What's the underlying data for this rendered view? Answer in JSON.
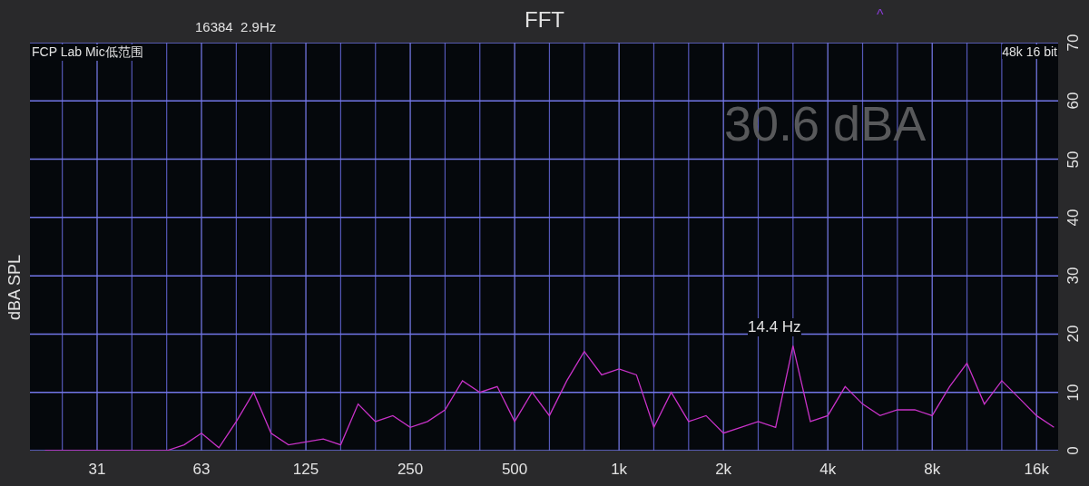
{
  "header": {
    "sample_info": "16384  2.9Hz",
    "marker": "^"
  },
  "plot": {
    "format": "48k 16 bit",
    "level_reading": "30.6 dBA",
    "peak_label": "14.4 Hz",
    "chart_data": {
      "type": "line",
      "title": "FFT",
      "ylabel": "dBA SPL",
      "ylim": [
        0,
        70
      ],
      "grid": true,
      "categories": [
        null,
        null,
        null,
        "31",
        null,
        null,
        null,
        null,
        null,
        "63",
        null,
        null,
        null,
        null,
        null,
        "125",
        null,
        null,
        null,
        null,
        null,
        "250",
        null,
        null,
        null,
        null,
        null,
        "500",
        null,
        null,
        null,
        null,
        null,
        "1k",
        null,
        null,
        null,
        null,
        null,
        "2k",
        null,
        null,
        null,
        null,
        null,
        "4k",
        null,
        null,
        null,
        null,
        null,
        "8k",
        null,
        null,
        null,
        null,
        null,
        "16k",
        null
      ],
      "series": [
        {
          "name": "FCP Lab Mic低范围",
          "color": "#c832c8",
          "values": [
            0,
            0,
            0,
            0,
            0,
            0,
            0,
            0,
            1,
            3,
            0.5,
            5,
            10,
            3,
            1,
            1.5,
            2,
            1,
            8,
            5,
            6,
            4,
            5,
            7,
            12,
            10,
            11,
            5,
            10,
            6,
            12,
            17,
            13,
            14,
            13,
            4,
            10,
            5,
            6,
            3,
            4,
            5,
            4,
            18,
            5,
            6,
            11,
            8,
            6,
            7,
            7,
            6,
            11,
            15,
            8,
            12,
            9,
            6,
            4
          ]
        }
      ],
      "yticks": [
        {
          "value": 0,
          "label": "0"
        },
        {
          "value": 10,
          "label": "10"
        },
        {
          "value": 20,
          "label": "20"
        },
        {
          "value": 30,
          "label": "30"
        },
        {
          "value": 40,
          "label": "40"
        },
        {
          "value": 50,
          "label": "50"
        },
        {
          "value": 60,
          "label": "60"
        },
        {
          "value": 70,
          "label": "70"
        }
      ]
    }
  }
}
